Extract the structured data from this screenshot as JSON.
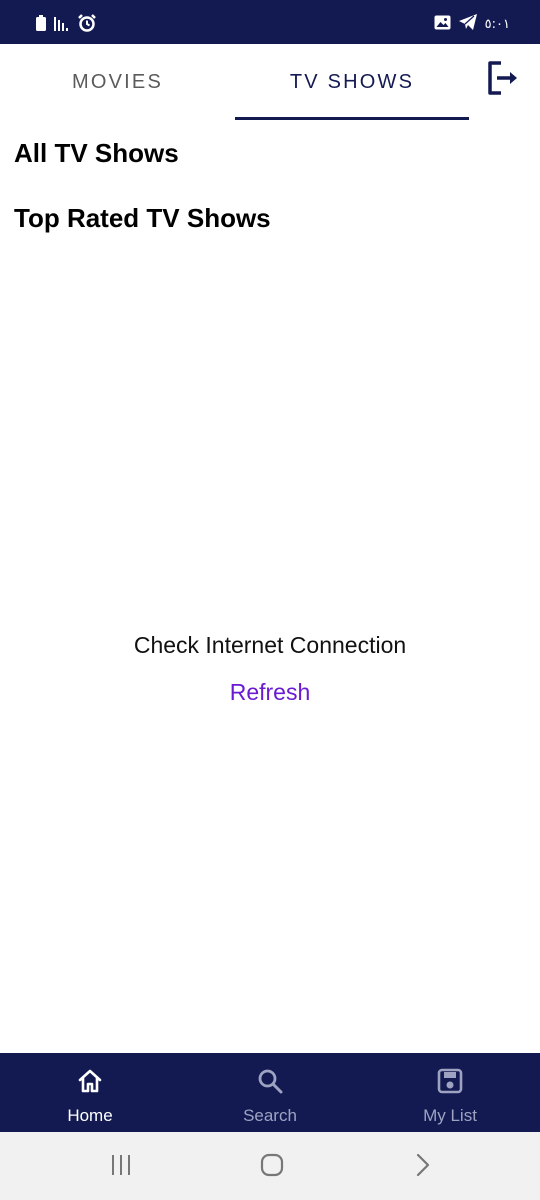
{
  "status_bar": {
    "time": "٥:٠١",
    "left_icons": [
      "battery-icon",
      "signal-icon",
      "alarm-icon"
    ],
    "right_icons": [
      "gallery-icon",
      "telegram-icon"
    ]
  },
  "tabs": [
    {
      "label": "MOVIES",
      "active": false
    },
    {
      "label": "TV SHOWS",
      "active": true
    }
  ],
  "header": {
    "logout_icon": "logout-icon"
  },
  "sections": {
    "all_title": "All TV Shows",
    "top_rated_title": "Top Rated TV Shows"
  },
  "error": {
    "message": "Check Internet Connection",
    "refresh_label": "Refresh"
  },
  "bottom_nav": {
    "items": [
      {
        "label": "Home",
        "icon": "home-icon",
        "active": true
      },
      {
        "label": "Search",
        "icon": "search-icon",
        "active": false
      },
      {
        "label": "My List",
        "icon": "save-icon",
        "active": false
      }
    ]
  },
  "system_nav": [
    "recents-icon",
    "home-circle-icon",
    "back-icon"
  ],
  "colors": {
    "primary": "#131a52",
    "accent": "#6a1bd1",
    "tab_inactive": "#5b5b5b",
    "nav_inactive": "#9ea3c2"
  }
}
